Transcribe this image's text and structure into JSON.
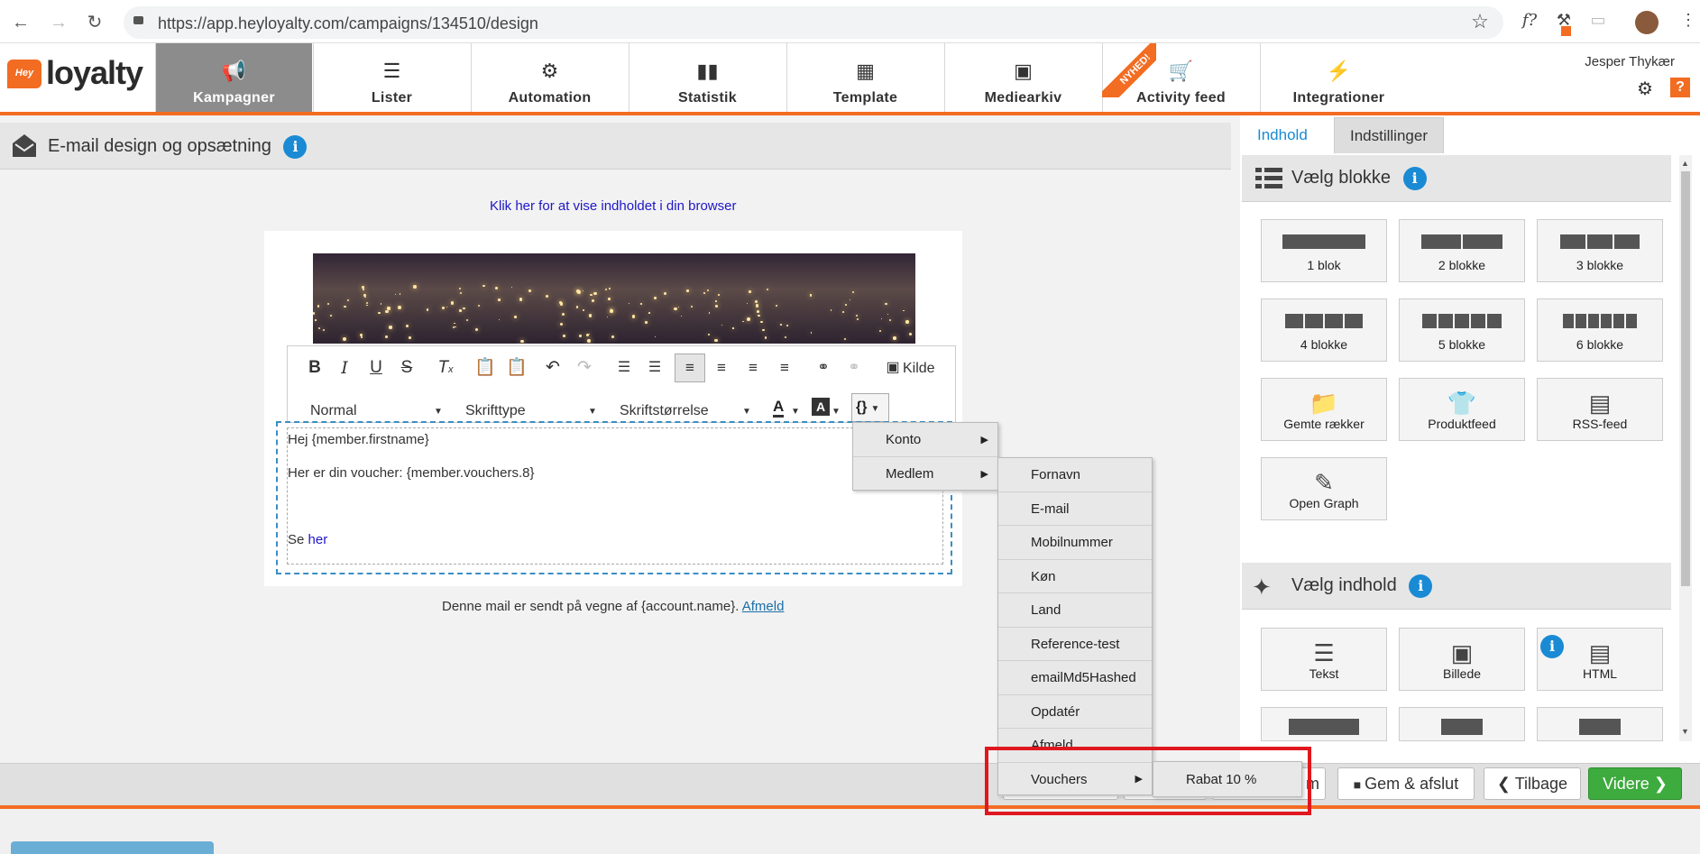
{
  "browser": {
    "url": "https://app.heyloyalty.com/campaigns/134510/design",
    "ext_label": "f?"
  },
  "header": {
    "logo_badge": "Hey",
    "logo_text": "loyalty",
    "user_name": "Jesper Thykær",
    "ribbon": "NYHED!",
    "nav": [
      {
        "label": "Kampagner",
        "icon": "megaphone-icon"
      },
      {
        "label": "Lister",
        "icon": "list-icon"
      },
      {
        "label": "Automation",
        "icon": "gears-icon"
      },
      {
        "label": "Statistik",
        "icon": "bar-chart-icon"
      },
      {
        "label": "Template",
        "icon": "template-icon"
      },
      {
        "label": "Mediearkiv",
        "icon": "image-icon"
      },
      {
        "label": "Activity feed",
        "icon": "cart-icon"
      },
      {
        "label": "Integrationer",
        "icon": "plug-icon"
      }
    ],
    "help": "?"
  },
  "page": {
    "title": "E-mail design og opsætning",
    "browser_link": "Klik her for at vise indholdet i din browser"
  },
  "editor": {
    "toolbar": {
      "kilde": "Kilde",
      "format": "Normal",
      "font": "Skrifttype",
      "size": "Skriftstørrelse"
    },
    "line1": "Hej {member.firstname}",
    "line2": "Her er din voucher: {member.vouchers.8}",
    "line3_prefix": "Se ",
    "line3_link": "her"
  },
  "footnote": {
    "text": "Denne mail er sendt på vegne af {account.name}.",
    "link": "Afmeld"
  },
  "menu1": [
    "Konto",
    "Medlem"
  ],
  "menu2": [
    "Fornavn",
    "E-mail",
    "Mobilnummer",
    "Køn",
    "Land",
    "Reference-test",
    "emailMd5Hashed",
    "Opdatér",
    "Afmeld",
    "Vouchers"
  ],
  "menu3": [
    "Rabat 10 %"
  ],
  "bottom": {
    "partial": "m",
    "save_close": "Gem & afslut",
    "back": "Tilbage",
    "next": "Videre"
  },
  "right": {
    "tabs": [
      "Indhold",
      "Indstillinger"
    ],
    "blocks_title": "Vælg blokke",
    "blocks": [
      "1 blok",
      "2 blokke",
      "3 blokke",
      "4 blokke",
      "5 blokke",
      "6 blokke",
      "Gemte rækker",
      "Produktfeed",
      "RSS-feed",
      "Open Graph"
    ],
    "content_title": "Vælg indhold",
    "content": [
      "Tekst",
      "Billede",
      "HTML"
    ]
  }
}
